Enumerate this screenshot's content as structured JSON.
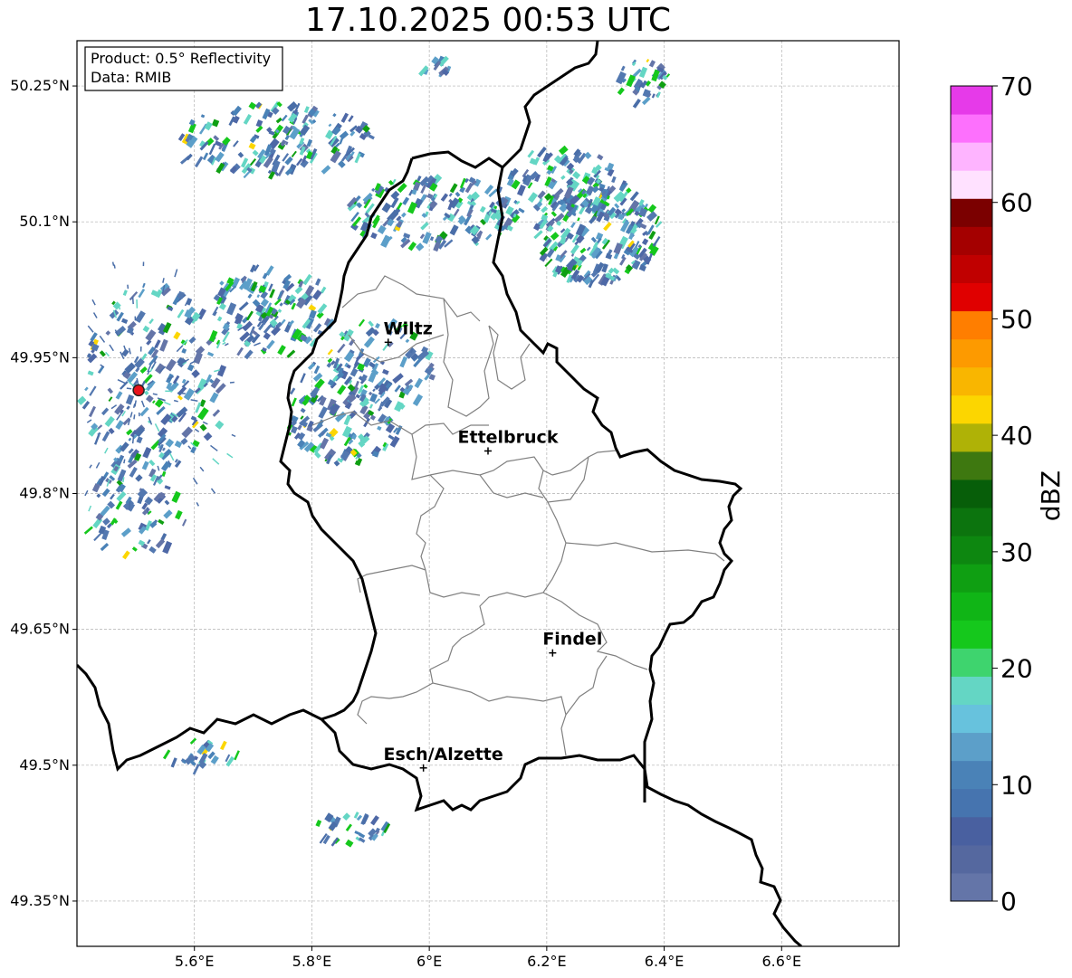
{
  "title": "17.10.2025 00:53 UTC",
  "info_box": {
    "product": "Product: 0.5° Reflectivity",
    "data": "Data: RMIB"
  },
  "map": {
    "lon_range": [
      5.4,
      6.8
    ],
    "lat_range": [
      49.3,
      50.3
    ],
    "lon_ticks": [
      {
        "value": 5.6,
        "label": "5.6°E"
      },
      {
        "value": 5.8,
        "label": "5.8°E"
      },
      {
        "value": 6.0,
        "label": "6°E"
      },
      {
        "value": 6.2,
        "label": "6.2°E"
      },
      {
        "value": 6.4,
        "label": "6.4°E"
      },
      {
        "value": 6.6,
        "label": "6.6°E"
      }
    ],
    "lat_ticks": [
      {
        "value": 50.25,
        "label": "50.25°N"
      },
      {
        "value": 50.1,
        "label": "50.1°N"
      },
      {
        "value": 49.95,
        "label": "49.95°N"
      },
      {
        "value": 49.8,
        "label": "49.8°N"
      },
      {
        "value": 49.65,
        "label": "49.65°N"
      },
      {
        "value": 49.5,
        "label": "49.5°N"
      },
      {
        "value": 49.35,
        "label": "49.35°N"
      }
    ],
    "cities": [
      {
        "name": "Wiltz",
        "lon": 5.93,
        "lat": 49.967
      },
      {
        "name": "Ettelbruck",
        "lon": 6.1,
        "lat": 49.847
      },
      {
        "name": "Findel",
        "lon": 6.21,
        "lat": 49.624
      },
      {
        "name": "Esch/Alzette",
        "lon": 5.99,
        "lat": 49.497
      }
    ],
    "radar_site": {
      "lon": 5.505,
      "lat": 49.914,
      "color": "#e8131b"
    },
    "grid": true
  },
  "colorbar": {
    "label": "dBZ",
    "min": 0,
    "max": 70,
    "step": 2.5,
    "ticks": [
      0,
      10,
      20,
      30,
      40,
      50,
      60,
      70
    ],
    "colors": [
      "#6475a8",
      "#55689f",
      "#4960a0",
      "#4674af",
      "#4a82b7",
      "#5c9fc9",
      "#67c2dd",
      "#64d6c4",
      "#3ed46e",
      "#15c81c",
      "#10b516",
      "#0f9f12",
      "#0d8710",
      "#0c740e",
      "#075e09",
      "#3e7810",
      "#afb206",
      "#fcd600",
      "#f9b600",
      "#fd9a00",
      "#ff7e00",
      "#e00000",
      "#c00000",
      "#a40000",
      "#7b0000",
      "#ffe1ff",
      "#feb4ff",
      "#fd70fd",
      "#e63ae9"
    ]
  }
}
